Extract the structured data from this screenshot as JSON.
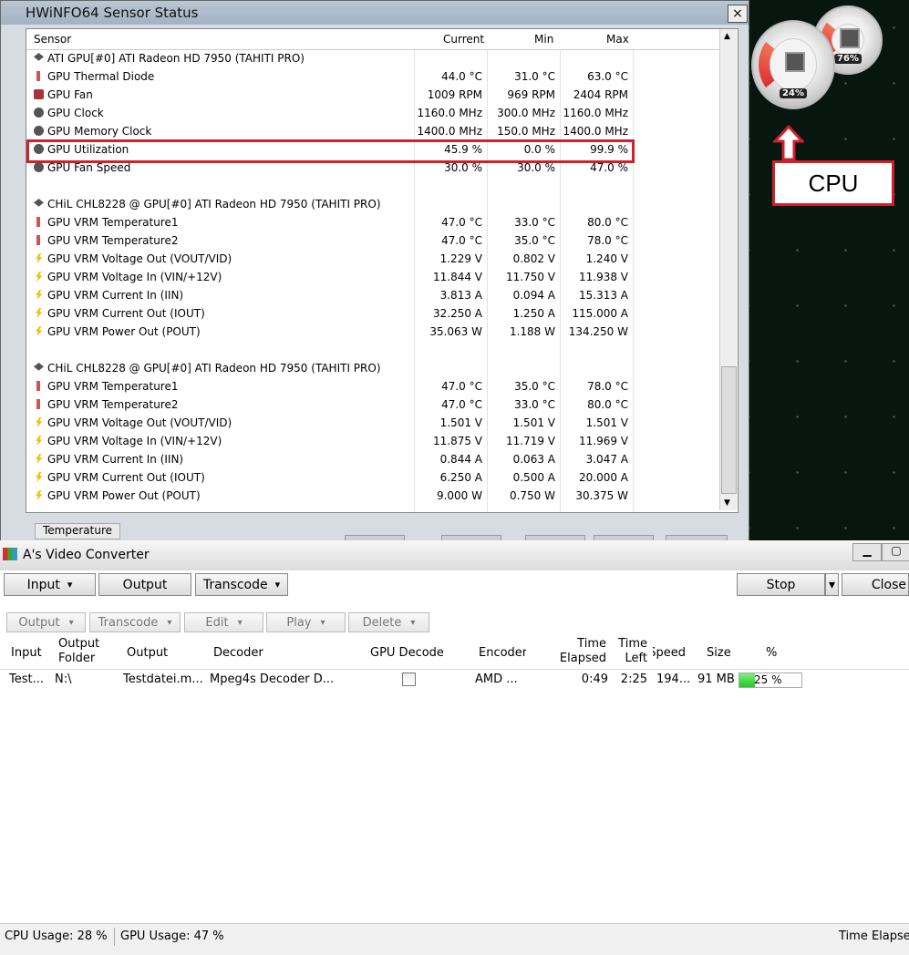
{
  "hwinfo": {
    "title": "HWiNFO64 Sensor Status",
    "close": "×",
    "columns": [
      "Sensor",
      "Current",
      "Min",
      "Max"
    ],
    "rows": [
      {
        "icon": "chip",
        "name": "ATI GPU[#0] ATI Radeon HD 7950 (TAHITI PRO)",
        "cur": "",
        "min": "",
        "max": ""
      },
      {
        "icon": "temp",
        "name": "GPU Thermal Diode",
        "cur": "44.0 °C",
        "min": "31.0 °C",
        "max": "63.0 °C"
      },
      {
        "icon": "fan",
        "name": "GPU Fan",
        "cur": "1009 RPM",
        "min": "969 RPM",
        "max": "2404 RPM"
      },
      {
        "icon": "gauge",
        "name": "GPU Clock",
        "cur": "1160.0 MHz",
        "min": "300.0 MHz",
        "max": "1160.0 MHz"
      },
      {
        "icon": "gauge",
        "name": "GPU Memory Clock",
        "cur": "1400.0 MHz",
        "min": "150.0 MHz",
        "max": "1400.0 MHz"
      },
      {
        "icon": "gauge",
        "name": "GPU Utilization",
        "cur": "45.9 %",
        "min": "0.0 %",
        "max": "99.9 %"
      },
      {
        "icon": "gauge",
        "name": "GPU Fan Speed",
        "cur": "30.0 %",
        "min": "30.0 %",
        "max": "47.0 %"
      },
      {
        "icon": "",
        "name": "",
        "cur": "",
        "min": "",
        "max": ""
      },
      {
        "icon": "chip",
        "name": "CHiL CHL8228 @ GPU[#0] ATI Radeon HD 7950 (TAHITI PRO)",
        "cur": "",
        "min": "",
        "max": ""
      },
      {
        "icon": "temp",
        "name": "GPU VRM Temperature1",
        "cur": "47.0 °C",
        "min": "33.0 °C",
        "max": "80.0 °C"
      },
      {
        "icon": "temp",
        "name": "GPU VRM Temperature2",
        "cur": "47.0 °C",
        "min": "35.0 °C",
        "max": "78.0 °C"
      },
      {
        "icon": "volt",
        "name": "GPU VRM Voltage Out (VOUT/VID)",
        "cur": "1.229 V",
        "min": "0.802 V",
        "max": "1.240 V"
      },
      {
        "icon": "volt",
        "name": "GPU VRM Voltage In (VIN/+12V)",
        "cur": "11.844 V",
        "min": "11.750 V",
        "max": "11.938 V"
      },
      {
        "icon": "volt",
        "name": "GPU VRM Current In (IIN)",
        "cur": "3.813 A",
        "min": "0.094 A",
        "max": "15.313 A"
      },
      {
        "icon": "volt",
        "name": "GPU VRM Current Out (IOUT)",
        "cur": "32.250 A",
        "min": "1.250 A",
        "max": "115.000 A"
      },
      {
        "icon": "volt",
        "name": "GPU VRM Power Out (POUT)",
        "cur": "35.063 W",
        "min": "1.188 W",
        "max": "134.250 W"
      },
      {
        "icon": "",
        "name": "",
        "cur": "",
        "min": "",
        "max": ""
      },
      {
        "icon": "chip",
        "name": "CHiL CHL8228 @ GPU[#0] ATI Radeon HD 7950 (TAHITI PRO)",
        "cur": "",
        "min": "",
        "max": ""
      },
      {
        "icon": "temp",
        "name": "GPU VRM Temperature1",
        "cur": "47.0 °C",
        "min": "35.0 °C",
        "max": "78.0 °C"
      },
      {
        "icon": "temp",
        "name": "GPU VRM Temperature2",
        "cur": "47.0 °C",
        "min": "33.0 °C",
        "max": "80.0 °C"
      },
      {
        "icon": "volt",
        "name": "GPU VRM Voltage Out (VOUT/VID)",
        "cur": "1.501 V",
        "min": "1.501 V",
        "max": "1.501 V"
      },
      {
        "icon": "volt",
        "name": "GPU VRM Voltage In (VIN/+12V)",
        "cur": "11.875 V",
        "min": "11.719 V",
        "max": "11.969 V"
      },
      {
        "icon": "volt",
        "name": "GPU VRM Current In (IIN)",
        "cur": "0.844 A",
        "min": "0.063 A",
        "max": "3.047 A"
      },
      {
        "icon": "volt",
        "name": "GPU VRM Current Out (IOUT)",
        "cur": "6.250 A",
        "min": "0.500 A",
        "max": "20.000 A"
      },
      {
        "icon": "volt",
        "name": "GPU VRM Power Out (POUT)",
        "cur": "9.000 W",
        "min": "0.750 W",
        "max": "30.375 W"
      }
    ],
    "tab": "Temperature",
    "highlight_color": "#d0202c"
  },
  "gadget": {
    "cpu_pct": "24%",
    "mem_pct": "76%",
    "label": "CPU"
  },
  "converter": {
    "title": "A's Video Converter",
    "toolbar": {
      "input": "Input",
      "output": "Output",
      "transcode": "Transcode",
      "stop": "Stop",
      "close": "Close"
    },
    "subtoolbar": {
      "output": "Output",
      "transcode": "Transcode",
      "edit": "Edit",
      "play": "Play",
      "delete": "Delete"
    },
    "headers": {
      "input": "Input",
      "output_folder": "Output\nFolder",
      "output": "Output",
      "decoder": "Decoder",
      "gpu_decode": "GPU Decode",
      "encoder": "Encoder",
      "time_elapsed": "Time\nElapsed",
      "time_left": "Time\nLeft",
      "speed": "Speed",
      "size": "Size",
      "pct": "%"
    },
    "row": {
      "input": "Test...",
      "output_folder": "N:\\",
      "output": "Testdatei.m...",
      "decoder": "Mpeg4s Decoder D...",
      "encoder": "AMD ...",
      "time_elapsed": "0:49",
      "time_left": "2:25",
      "speed": "194...",
      "size": "91 MB",
      "pct": "25 %",
      "progress": 0.25
    },
    "status": {
      "cpu": "CPU Usage: 28 %",
      "gpu": "GPU Usage: 47 %",
      "right": "Time Elapsed"
    }
  }
}
